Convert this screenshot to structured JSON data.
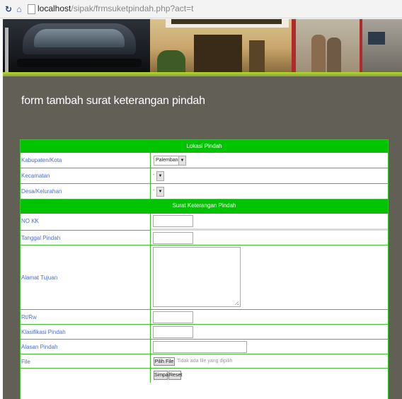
{
  "browser": {
    "url_host": "localhost",
    "url_path": "/sipak/frmsuketpindah.php?act=t"
  },
  "page": {
    "title": "form tambah surat keterangan pindah"
  },
  "form": {
    "section_location": "Lokasi Pindah",
    "section_letter": "Surat Keterangan Pindah",
    "fields": {
      "kabupaten_label": "Kabupaten/Kota",
      "kabupaten_value": "Palembang",
      "kecamatan_label": "Kecamatan",
      "kecamatan_value": "",
      "desa_label": "Desa/Kelurahan",
      "desa_value": "",
      "nokk_label": "NO KK",
      "nokk_value": "",
      "tanggal_label": "Tanggal Pindah",
      "tanggal_value": "",
      "alamat_label": "Alamat Tujuan",
      "alamat_value": "",
      "rtrw_label": "Rt/Rw",
      "rtrw_value": "",
      "klasifikasi_label": "Klasifikasi Pindah",
      "klasifikasi_value": "",
      "alasan_label": "Alasan Pindah",
      "alasan_value": "",
      "file_label": "File"
    },
    "file_button": "Pilih File",
    "file_status": "Tidak ada file yang dipilih",
    "save_button": "Simpan",
    "reset_button": "Reset"
  },
  "colors": {
    "header_green": "#00c400",
    "border_green": "#39c52a",
    "label_blue": "#4d6dd8",
    "page_bg": "#625f57",
    "banner_accent": "#86a81e"
  },
  "icons": [
    "reload-icon",
    "home-icon",
    "page-icon",
    "dropdown-arrow-icon"
  ]
}
